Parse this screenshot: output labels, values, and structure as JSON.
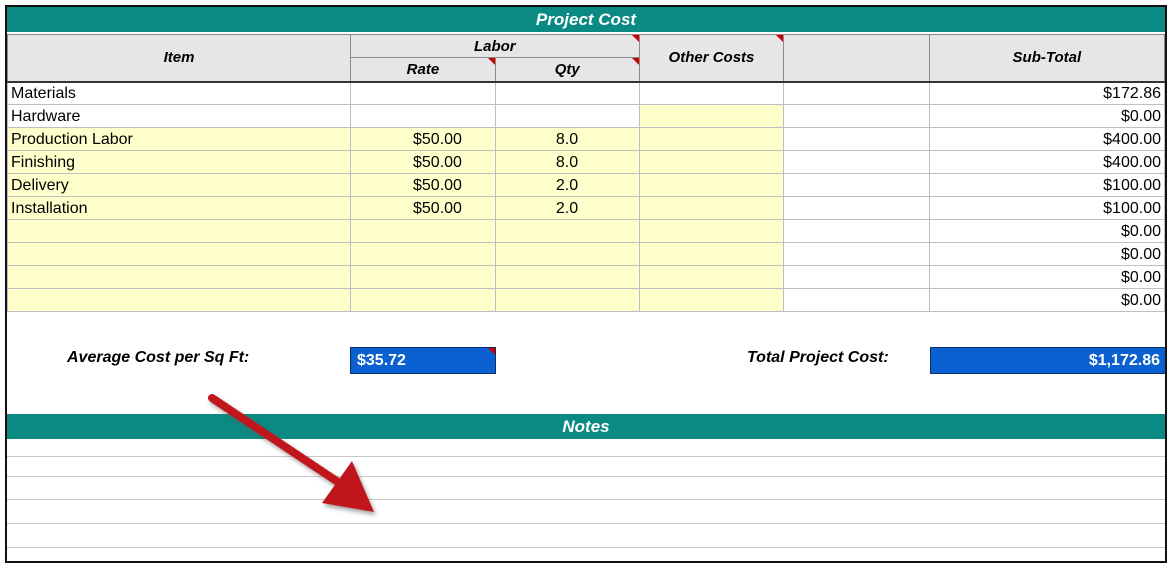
{
  "title": "Project Cost",
  "headers": {
    "item": "Item",
    "labor": "Labor",
    "rate": "Rate",
    "qty": "Qty",
    "other_costs": "Other Costs",
    "blank": "",
    "subtotal": "Sub-Total"
  },
  "rows": [
    {
      "item": "Materials",
      "rate": "",
      "qty": "",
      "other": "",
      "extra": "",
      "subtotal": "$172.86"
    },
    {
      "item": "Hardware",
      "rate": "",
      "qty": "",
      "other": "",
      "extra": "",
      "subtotal": "$0.00"
    },
    {
      "item": "Production Labor",
      "rate": "$50.00",
      "qty": "8.0",
      "other": "",
      "extra": "",
      "subtotal": "$400.00"
    },
    {
      "item": "Finishing",
      "rate": "$50.00",
      "qty": "8.0",
      "other": "",
      "extra": "",
      "subtotal": "$400.00"
    },
    {
      "item": "Delivery",
      "rate": "$50.00",
      "qty": "2.0",
      "other": "",
      "extra": "",
      "subtotal": "$100.00"
    },
    {
      "item": "Installation",
      "rate": "$50.00",
      "qty": "2.0",
      "other": "",
      "extra": "",
      "subtotal": "$100.00"
    },
    {
      "item": "",
      "rate": "",
      "qty": "",
      "other": "",
      "extra": "",
      "subtotal": "$0.00"
    },
    {
      "item": "",
      "rate": "",
      "qty": "",
      "other": "",
      "extra": "",
      "subtotal": "$0.00"
    },
    {
      "item": "",
      "rate": "",
      "qty": "",
      "other": "",
      "extra": "",
      "subtotal": "$0.00"
    },
    {
      "item": "",
      "rate": "",
      "qty": "",
      "other": "",
      "extra": "",
      "subtotal": "$0.00"
    }
  ],
  "summary": {
    "avg_label": "Average Cost per Sq Ft:",
    "avg_value": "$35.72",
    "total_label": "Total Project Cost:",
    "total_value": "$1,172.86"
  },
  "notes_title": "Notes",
  "colors": {
    "header_bar": "#0a8a83",
    "input_fill": "#ffffcc",
    "total_fill": "#0a5fd1",
    "arrow": "#c0161c",
    "comment_flag": "#d00000"
  },
  "icons": [
    "red-arrow-annotation",
    "comment-indicator"
  ]
}
